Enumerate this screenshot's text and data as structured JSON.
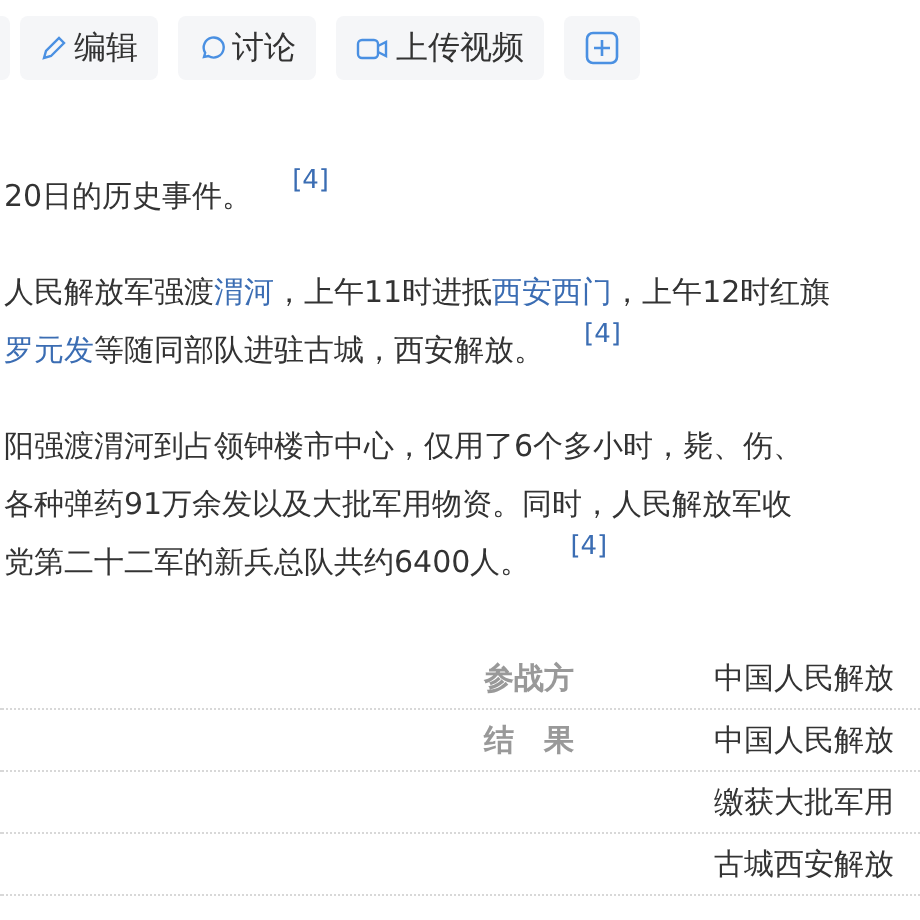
{
  "toolbar": {
    "buttons": [
      {
        "kind": "edit",
        "label": "编辑"
      },
      {
        "kind": "discuss",
        "label": "讨论"
      },
      {
        "kind": "video",
        "label": "上传视频"
      },
      {
        "kind": "add"
      }
    ]
  },
  "paragraphs": [
    {
      "lines": [
        {
          "segments": [
            {
              "text": "20日的历史事件。",
              "link": false
            }
          ],
          "ref": "[4]"
        }
      ]
    },
    {
      "lines": [
        {
          "segments": [
            {
              "text": "人民解放军强渡",
              "link": false
            },
            {
              "text": "渭河",
              "link": true
            },
            {
              "text": "，上午11时进抵",
              "link": false
            },
            {
              "text": "西安西门",
              "link": true
            },
            {
              "text": "，上午12时红旗",
              "link": false
            }
          ]
        },
        {
          "segments": [
            {
              "text": "罗元发",
              "link": true
            },
            {
              "text": "等随同部队进驻古城，西安解放。",
              "link": false
            }
          ],
          "ref": "[4]"
        }
      ]
    },
    {
      "lines": [
        {
          "segments": [
            {
              "text": "阳强渡渭河到占领钟楼市中心，仅用了6个多小时，毙、伤、",
              "link": false
            }
          ]
        },
        {
          "segments": [
            {
              "text": "各种弹药91万余发以及大批军用物资。同时，人民解放军收",
              "link": false
            }
          ]
        },
        {
          "segments": [
            {
              "text": "党第二十二军的新兵总队共约6400人。",
              "link": false
            }
          ],
          "ref": "[4]"
        }
      ]
    }
  ],
  "infobox": {
    "rows": [
      {
        "label": "参战方",
        "value": "中国人民解放"
      },
      {
        "label": "结　果",
        "value": "中国人民解放"
      },
      {
        "value": "缴获大批军用"
      },
      {
        "value": "古城西安解放"
      }
    ]
  }
}
